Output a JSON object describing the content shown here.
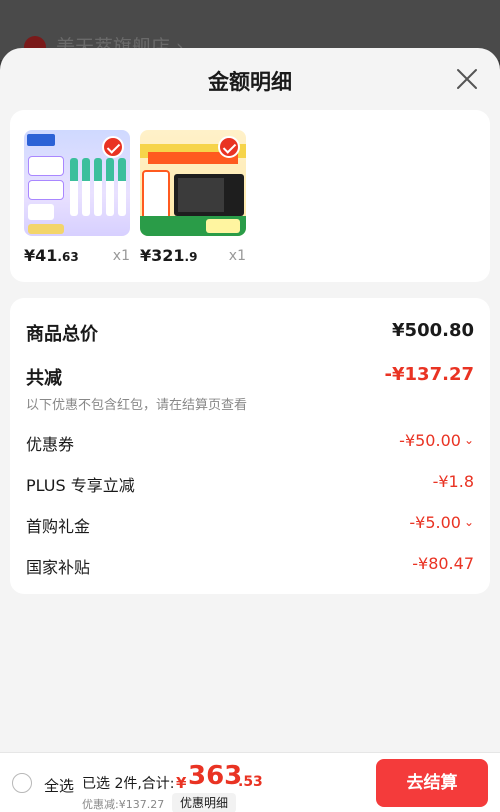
{
  "background": {
    "store_name": "美天萃旗舰店 ›"
  },
  "sheet": {
    "title": "金额明细",
    "close_icon": "close-icon"
  },
  "products": [
    {
      "price_int": "¥41",
      "price_dec": ".63",
      "qty": "x1"
    },
    {
      "price_int": "¥321",
      "price_dec": ".9",
      "qty": "x1"
    }
  ],
  "summary": {
    "total_label": "商品总价",
    "total_value": "¥500.80",
    "reduce_label": "共减",
    "reduce_value": "-¥137.27",
    "reduce_note": "以下优惠不包含红包，请在结算页查看",
    "items": [
      {
        "label": "优惠券",
        "value": "-¥50.00",
        "chevron": "⌄"
      },
      {
        "label": "PLUS 专享立减",
        "value": "-¥1.8"
      },
      {
        "label": "首购礼金",
        "value": "-¥5.00",
        "chevron": "⌄"
      },
      {
        "label": "国家补贴",
        "value": "-¥80.47"
      }
    ]
  },
  "bottom": {
    "select_all": "全选",
    "selected_text": "已选 2件,合计:",
    "currency": "¥",
    "total_int": "363",
    "total_dec": ".53",
    "discount_text": "优惠减:¥137.27",
    "detail_button": "优惠明细",
    "checkout_button": "去结算"
  },
  "colors": {
    "accent_red": "#e93323",
    "checkout_bg": "#f43b3b"
  }
}
